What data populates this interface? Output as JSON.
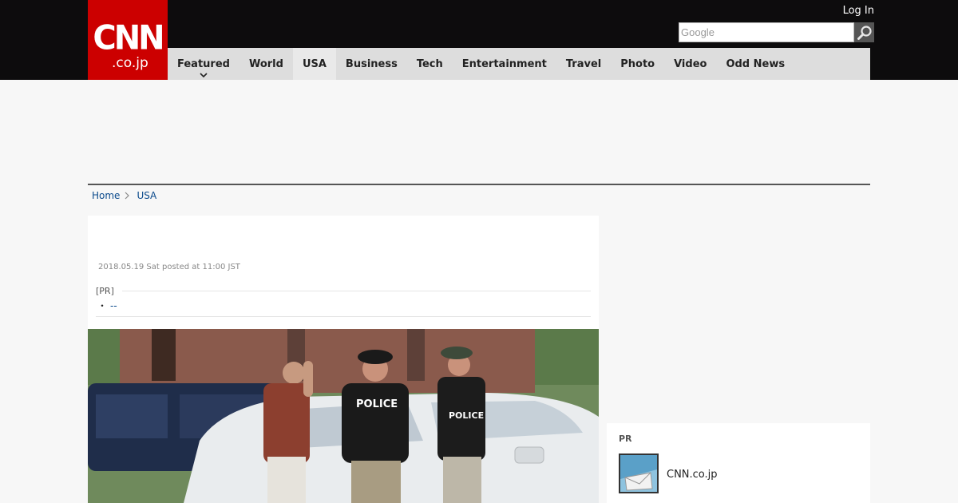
{
  "header": {
    "logo_main": "CNN",
    "logo_sub": ".co.jp",
    "login_label": "Log In",
    "search_placeholder": "Google"
  },
  "nav": [
    {
      "label": "Featured",
      "has_dropdown": true
    },
    {
      "label": "World"
    },
    {
      "label": "USA",
      "active": true
    },
    {
      "label": "Business"
    },
    {
      "label": "Tech"
    },
    {
      "label": "Entertainment"
    },
    {
      "label": "Travel"
    },
    {
      "label": "Photo"
    },
    {
      "label": "Video"
    },
    {
      "label": "Odd News"
    }
  ],
  "breadcrumb": {
    "home": "Home",
    "current": "USA"
  },
  "article": {
    "posted": "2018.05.19 Sat posted at 11:00 JST",
    "pr_label": "[PR]",
    "pr_bullet": "・",
    "pr_link": "--",
    "photo_text": "POLICE",
    "photo_text_2": "POLICE"
  },
  "sidebar": {
    "pr_label": "PR",
    "pr_item_name": "CNN.co.jp"
  },
  "colors": {
    "header_bg": "#0d0c0d",
    "logo_red": "#cc0000",
    "nav_bg": "#dddddd",
    "link_blue": "#0b4a8c"
  }
}
